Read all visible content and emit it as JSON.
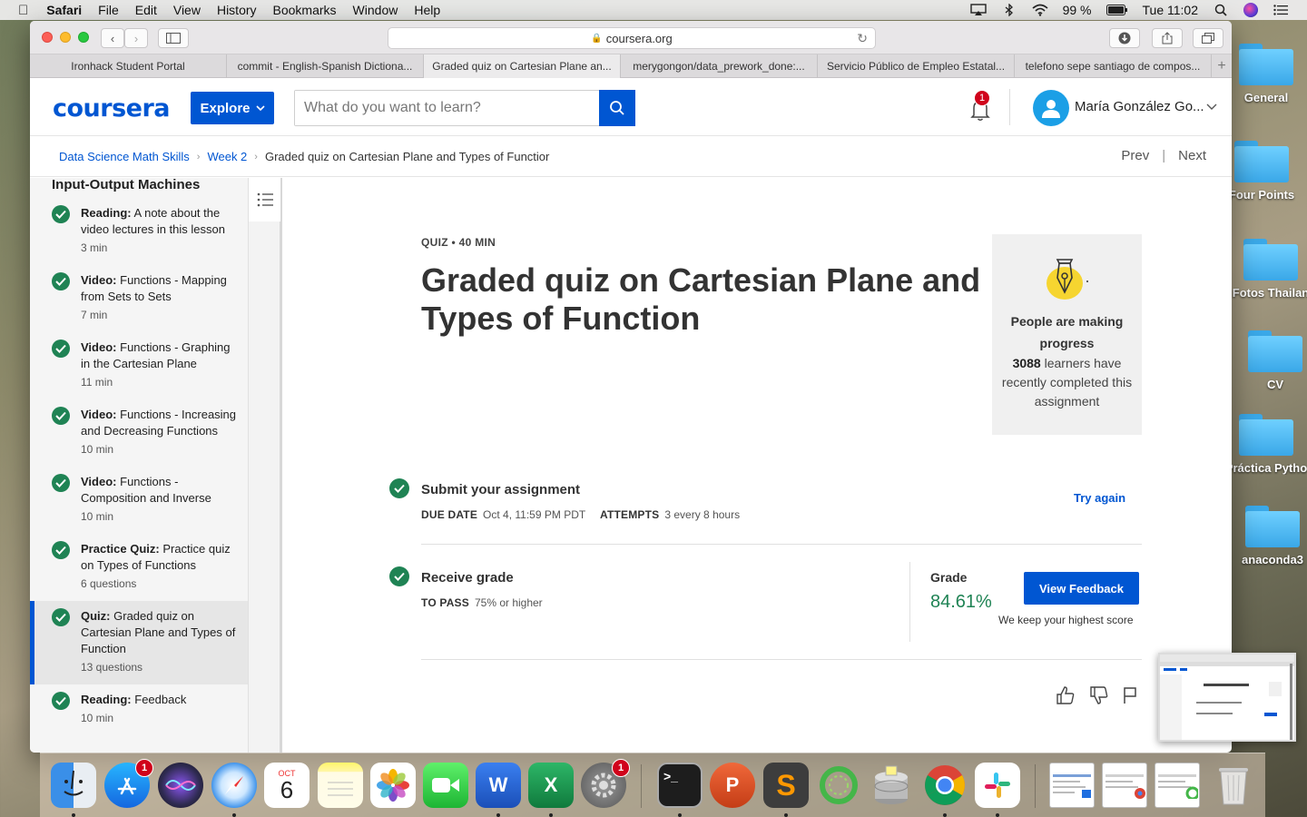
{
  "menubar": {
    "app": "Safari",
    "items": [
      "File",
      "Edit",
      "View",
      "History",
      "Bookmarks",
      "Window",
      "Help"
    ],
    "battery": "99 %",
    "clock": "Tue 11:02"
  },
  "desktop": {
    "folders": [
      "General",
      "Four Points",
      "Fotos Thailan",
      "CV",
      "Práctica Pytho",
      "anaconda3"
    ]
  },
  "browser": {
    "url": "coursera.org",
    "tabs": [
      "Ironhack Student Portal",
      "commit - English-Spanish Dictiona...",
      "Graded quiz on Cartesian Plane an...",
      "merygongon/data_prework_done:...",
      "Servicio Público de Empleo Estatal...",
      "telefono sepe santiago de compos..."
    ],
    "active_tab": 2
  },
  "header": {
    "logo": "coursera",
    "explore": "Explore",
    "search_placeholder": "What do you want to learn?",
    "notifications": "1",
    "user": "María González Go..."
  },
  "breadcrumb": {
    "items": [
      "Data Science Math Skills",
      "Week 2"
    ],
    "current": "Graded quiz on Cartesian Plane and Types of Functior",
    "prev": "Prev",
    "next": "Next"
  },
  "sidebar": {
    "section": "Input-Output Machines",
    "items": [
      {
        "type": "Reading:",
        "title": "A note about the video lectures in this lesson",
        "meta": "3 min"
      },
      {
        "type": "Video:",
        "title": "Functions - Mapping from Sets to Sets",
        "meta": "7 min"
      },
      {
        "type": "Video:",
        "title": "Functions - Graphing in the Cartesian Plane",
        "meta": "11 min"
      },
      {
        "type": "Video:",
        "title": "Functions - Increasing and Decreasing Functions",
        "meta": "10 min"
      },
      {
        "type": "Video:",
        "title": "Functions - Composition and Inverse",
        "meta": "10 min"
      },
      {
        "type": "Practice Quiz:",
        "title": "Practice quiz on Types of Functions",
        "meta": "6 questions"
      },
      {
        "type": "Quiz:",
        "title": "Graded quiz on Cartesian Plane and Types of Function",
        "meta": "13 questions"
      },
      {
        "type": "Reading:",
        "title": "Feedback",
        "meta": "10 min"
      }
    ]
  },
  "main": {
    "kicker": "QUIZ • 40 MIN",
    "title": "Graded quiz on Cartesian Plane and Types of Function",
    "progress": {
      "heading": "People are making progress",
      "count": "3088",
      "text": "learners have recently completed this assignment"
    },
    "submit": {
      "title": "Submit your assignment",
      "due_label": "DUE DATE",
      "due_value": "Oct 4, 11:59 PM PDT",
      "attempts_label": "ATTEMPTS",
      "attempts_value": "3 every 8 hours",
      "try_again": "Try again"
    },
    "grade": {
      "title": "Receive grade",
      "pass_label": "TO PASS",
      "pass_value": "75% or higher",
      "grade_label": "Grade",
      "grade_value": "84.61%",
      "view_feedback": "View Feedback",
      "note": "We keep your highest score"
    }
  },
  "dock": {
    "calendar_month": "OCT",
    "calendar_day": "6",
    "appstore_badge": "1",
    "prefs_badge": "1"
  }
}
